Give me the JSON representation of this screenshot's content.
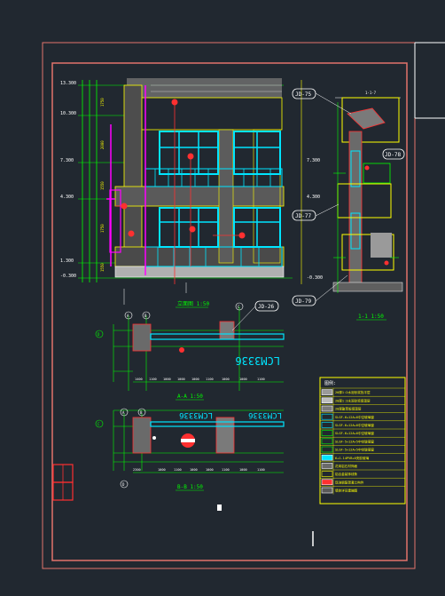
{
  "colors": {
    "background": "#212830",
    "frame": "#e2736b",
    "cad_green": "#00ff00",
    "cad_cyan": "#00e5ff",
    "cad_yellow": "#ffff00",
    "cad_magenta": "#ff00ff",
    "cad_red": "#ff3030",
    "cad_white": "#ffffff"
  },
  "elevation": {
    "caption": "立面图 1:50",
    "levels": [
      "13.300",
      "10.300",
      "7.300",
      "4.300",
      "1.300",
      "-0.300"
    ],
    "right_levels": [
      "7.300",
      "4.300",
      "-0.300"
    ],
    "spans": [
      "1750",
      "2000",
      "1550",
      "1750",
      "1550"
    ],
    "tags": [
      "JD-75",
      "JD-77",
      "JD-79"
    ]
  },
  "section_detail": {
    "caption": "1-1 1:50",
    "tag": "JD-78",
    "label_top": "1-1-7"
  },
  "plan_a": {
    "caption": "A-A 1:50",
    "tag": "JD-26",
    "window_label": "LCM3336",
    "dims": [
      "1400",
      "1100",
      "1000",
      "1000",
      "1000",
      "1100",
      "1000",
      "1000",
      "1100"
    ],
    "axes": [
      "A",
      "B",
      "C",
      "D"
    ]
  },
  "plan_b": {
    "caption": "B-B 1:50",
    "window_label_1": "LCM3336",
    "window_label_2": "LCM3336",
    "dims": [
      "2300",
      "1000",
      "1100",
      "1000",
      "1000",
      "1100",
      "1000",
      "1100"
    ],
    "axes": [
      "A",
      "B",
      "C",
      "D"
    ]
  },
  "legend": {
    "title": "图例:",
    "items": [
      "20厚1:2水泥砂浆找平层",
      "20厚1:3水泥砂浆保温层",
      "20厚聚苯板保温层",
      "SLGF-6+12A+6中空玻璃窗",
      "SLGF-6+12A+6中空玻璃窗",
      "SLGF-6+12A+6中空玻璃窗",
      "SLGF-5+12A+5中空玻璃窗",
      "SLGF-5+12A+5中空玻璃窗",
      "6+1.14PVB+6夹胶玻璃",
      "花岗岩石材饰面",
      "铝合金装饰线条",
      "现浇钢筋混凝土构件",
      "墙体详见建施图"
    ]
  }
}
